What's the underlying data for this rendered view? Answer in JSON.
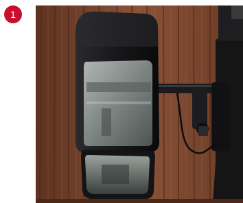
{
  "badge": {
    "label": "1",
    "color": "#c8102e"
  },
  "photo": {
    "subject": "truck-side-mirror",
    "colors": {
      "wall": "#7a4a33",
      "mirror_housing": "#1a1a1d",
      "glass": "#8a9393"
    }
  }
}
